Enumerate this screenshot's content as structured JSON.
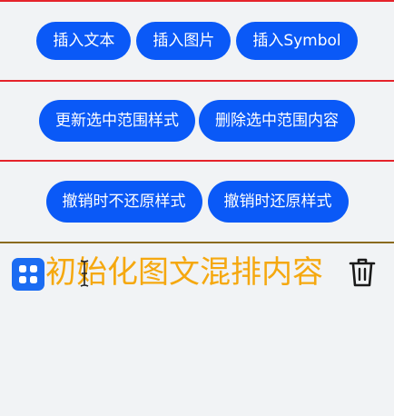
{
  "toolbar_row1": {
    "insert_text": "插入文本",
    "insert_image": "插入图片",
    "insert_symbol": "插入Symbol"
  },
  "toolbar_row2": {
    "update_range_style": "更新选中范围样式",
    "delete_range_content": "删除选中范围内容"
  },
  "toolbar_row3": {
    "undo_without_restore": "撤销时不还原样式",
    "undo_with_restore": "撤销时还原样式"
  },
  "editor": {
    "content_text": "初始化图文混排内容",
    "leading_icon": "app-grid-icon",
    "trailing_icon": "trash-icon",
    "text_color": "#f5a80f"
  },
  "colors": {
    "button_bg": "#0a59f7",
    "divider": "#e5232b",
    "background": "#f1f3f5"
  }
}
